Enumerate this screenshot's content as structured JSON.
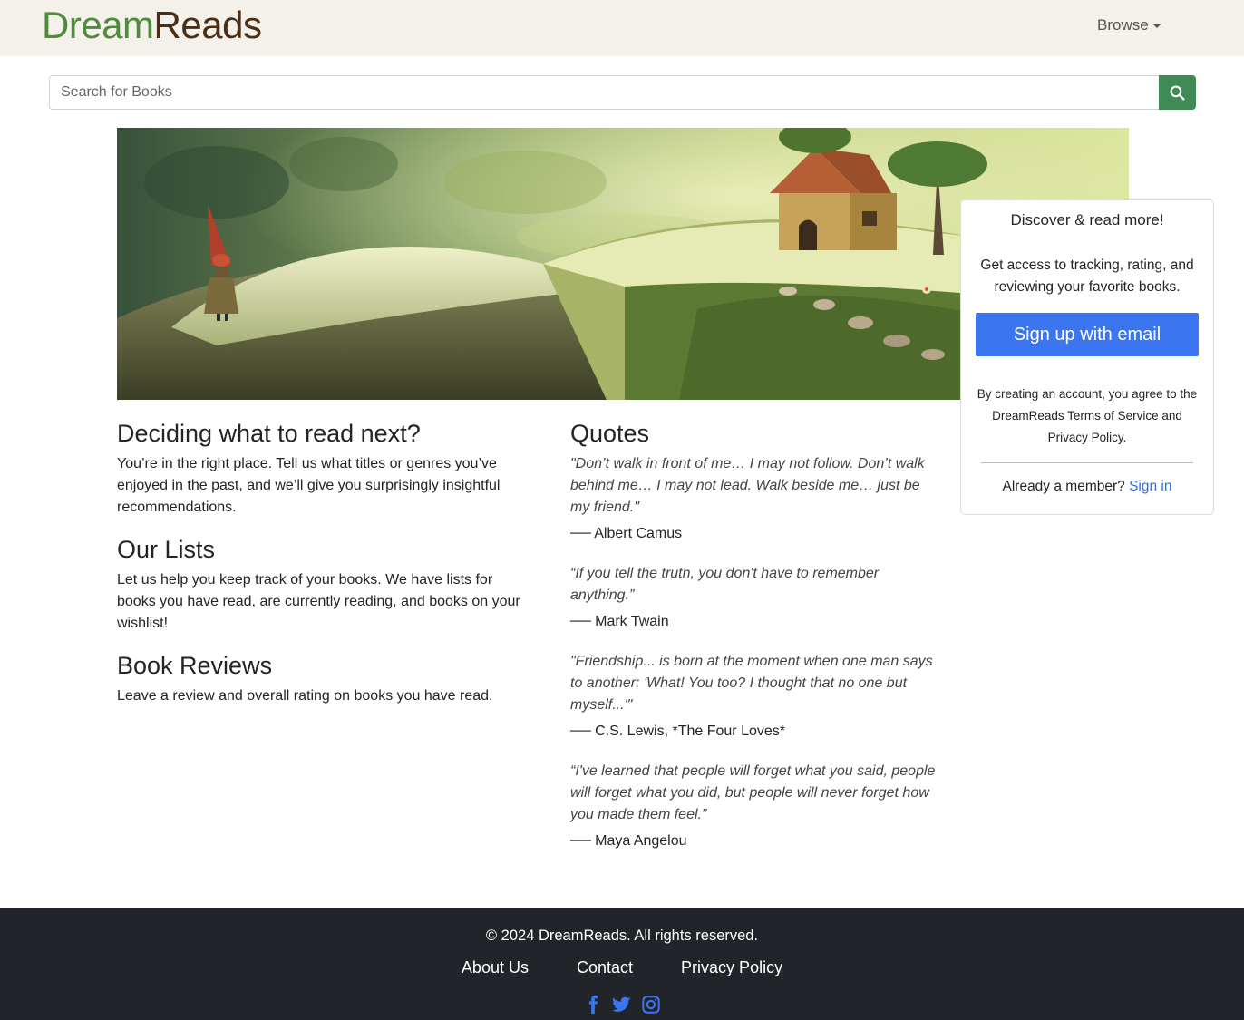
{
  "brand": {
    "part1": "Dream",
    "part2": "Reads",
    "color1": "#4e8b3a",
    "color2": "#4a2e16"
  },
  "nav": {
    "browse_label": "Browse"
  },
  "search": {
    "placeholder": "Search for Books",
    "button_icon": "search-icon",
    "button_color": "#3f8a55"
  },
  "hero": {
    "image": "book-fantasy-illustration"
  },
  "signup_card": {
    "title": "Discover & read more!",
    "description": "Get access to tracking, rating, and reviewing your favorite books.",
    "button_label": "Sign up with email",
    "legal": "By creating an account, you agree to the DreamReads Terms of Service and Privacy Policy.",
    "member_text": "Already a member?",
    "signin_label": "Sign in",
    "button_color": "#3b76f0"
  },
  "sections": [
    {
      "heading": "Deciding what to read next?",
      "text": "You’re in the right place. Tell us what titles or genres you’ve enjoyed in the past, and we’ll give you surprisingly insightful recommendations."
    },
    {
      "heading": "Our Lists",
      "text": "Let us help you keep track of your books. We have lists for books you have read, are currently reading, and books on your wishlist!"
    },
    {
      "heading": "Book Reviews",
      "text": "Leave a review and overall rating on books you have read."
    }
  ],
  "quotes": {
    "heading": "Quotes",
    "items": [
      {
        "text": "\"Don’t walk in front of me… I may not follow. Don’t walk behind me… I may not lead. Walk beside me… just be my friend.\"",
        "author": "── Albert Camus"
      },
      {
        "text": "“If you tell the truth, you don't have to remember anything.”",
        "author": "── Mark Twain"
      },
      {
        "text": "\"Friendship... is born at the moment when one man says to another: 'What! You too? I thought that no one but myself...'\"",
        "author": "── C.S. Lewis, *The Four Loves*"
      },
      {
        "text": "“I've learned that people will forget what you said, people will forget what you did, but people will never forget how you made them feel.”",
        "author": "── Maya Angelou"
      }
    ]
  },
  "footer": {
    "copyright": "© 2024 DreamReads. All rights reserved.",
    "links": [
      "About Us",
      "Contact",
      "Privacy Policy"
    ],
    "social_icons": [
      "facebook-icon",
      "twitter-icon",
      "instagram-icon"
    ],
    "icon_color": "#3b76f0"
  }
}
